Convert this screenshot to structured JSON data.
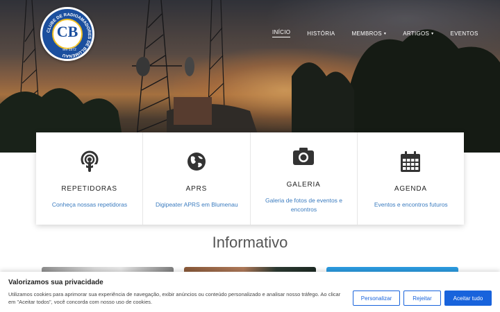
{
  "logo": {
    "ring_text": "CLUBE DE RADIOAMADORES DE BLUMENAU",
    "monogram": "CB",
    "founded_line1": "Fundado",
    "founded_line2": "em 1972"
  },
  "nav": {
    "items": [
      {
        "label": "Início",
        "active": true,
        "dropdown": false
      },
      {
        "label": "História",
        "active": false,
        "dropdown": false
      },
      {
        "label": "Membros",
        "active": false,
        "dropdown": true
      },
      {
        "label": "Artigos",
        "active": false,
        "dropdown": true
      },
      {
        "label": "Eventos",
        "active": false,
        "dropdown": false
      }
    ],
    "caret_glyph": "▾"
  },
  "cards": [
    {
      "icon": "podcast-icon",
      "title": "REPETIDORAS",
      "desc": "Conheça nossas repetidoras"
    },
    {
      "icon": "globe-icon",
      "title": "APRS",
      "desc": "Digipeater APRS em Blumenau"
    },
    {
      "icon": "camera-icon",
      "title": "GALERIA",
      "desc": "Galeria de fotos de eventos e encontros"
    },
    {
      "icon": "calendar-icon",
      "title": "AGENDA",
      "desc": "Eventos e encontros futuros"
    }
  ],
  "section": {
    "title": "Informativo"
  },
  "cookie": {
    "title": "Valorizamos sua privacidade",
    "text": "Utilizamos cookies para aprimorar sua experiência de navegação, exibir anúncios ou conteúdo personalizado e analisar nosso tráfego. Ao clicar em \"Aceitar todos\", você concorda com nosso uso de cookies.",
    "customize": "Personalizar",
    "reject": "Rejeitar",
    "accept": "Aceitar tudo"
  },
  "colors": {
    "accent": "#1863dc",
    "link": "#3a7bbf",
    "logo_blue": "#1b4f9e"
  }
}
